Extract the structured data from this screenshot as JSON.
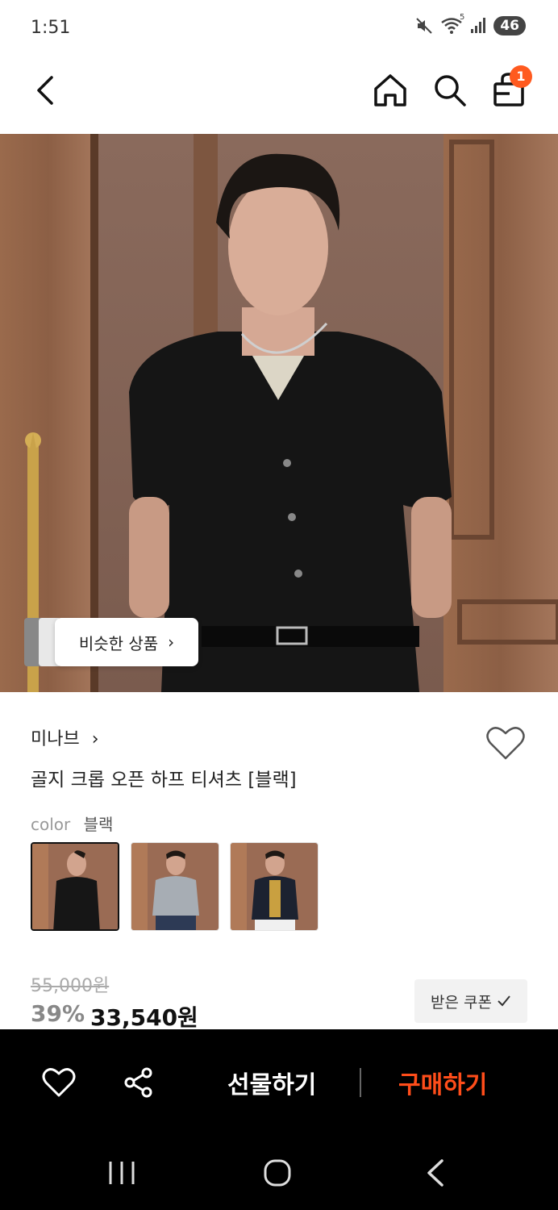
{
  "status": {
    "time": "1:51",
    "battery": "46",
    "signal_label": "5"
  },
  "header": {
    "cart_count": "1"
  },
  "hero": {
    "similar_label": "비슷한 상품"
  },
  "product": {
    "brand": "미나브",
    "title": "골지 크롭 오픈 하프 티셔츠 [블랙]",
    "color_label": "color",
    "color_value": "블랙",
    "swatches": [
      "black",
      "gray",
      "navy"
    ],
    "original_price": "55,000원",
    "discount": "39%",
    "price": "33,540원",
    "coupon_label": "받은 쿠폰"
  },
  "actions": {
    "gift": "선물하기",
    "buy": "구매하기"
  },
  "colors": {
    "accent": "#ff4d1a",
    "badge": "#ff5a1f",
    "bar": "#000000"
  }
}
